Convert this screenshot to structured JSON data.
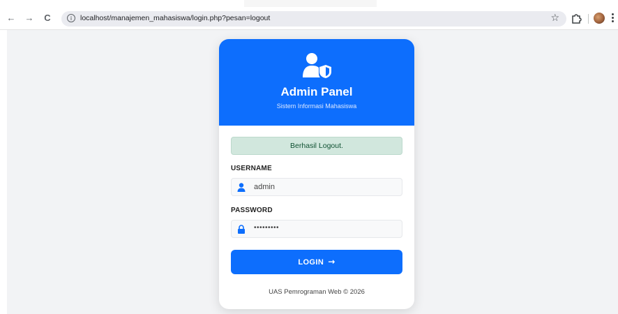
{
  "browser": {
    "back_icon": "←",
    "forward_icon": "→",
    "reload_icon": "C",
    "info_icon": "i",
    "url": "localhost/manajemen_mahasiswa/login.php?pesan=logout",
    "star_icon": "☆"
  },
  "card": {
    "title": "Admin Panel",
    "subtitle": "Sistem Informasi Mahasiswa",
    "alert": "Berhasil Logout.",
    "username_label": "USERNAME",
    "username_value": "admin",
    "password_label": "PASSWORD",
    "password_value": "•••••••••",
    "login_label": "LOGIN",
    "login_arrow": "→",
    "footer": "UAS Pemrograman Web © 2026"
  },
  "colors": {
    "primary": "#0d6efd",
    "alert_bg": "#d1e7dd",
    "page_bg": "#f2f3f5"
  }
}
